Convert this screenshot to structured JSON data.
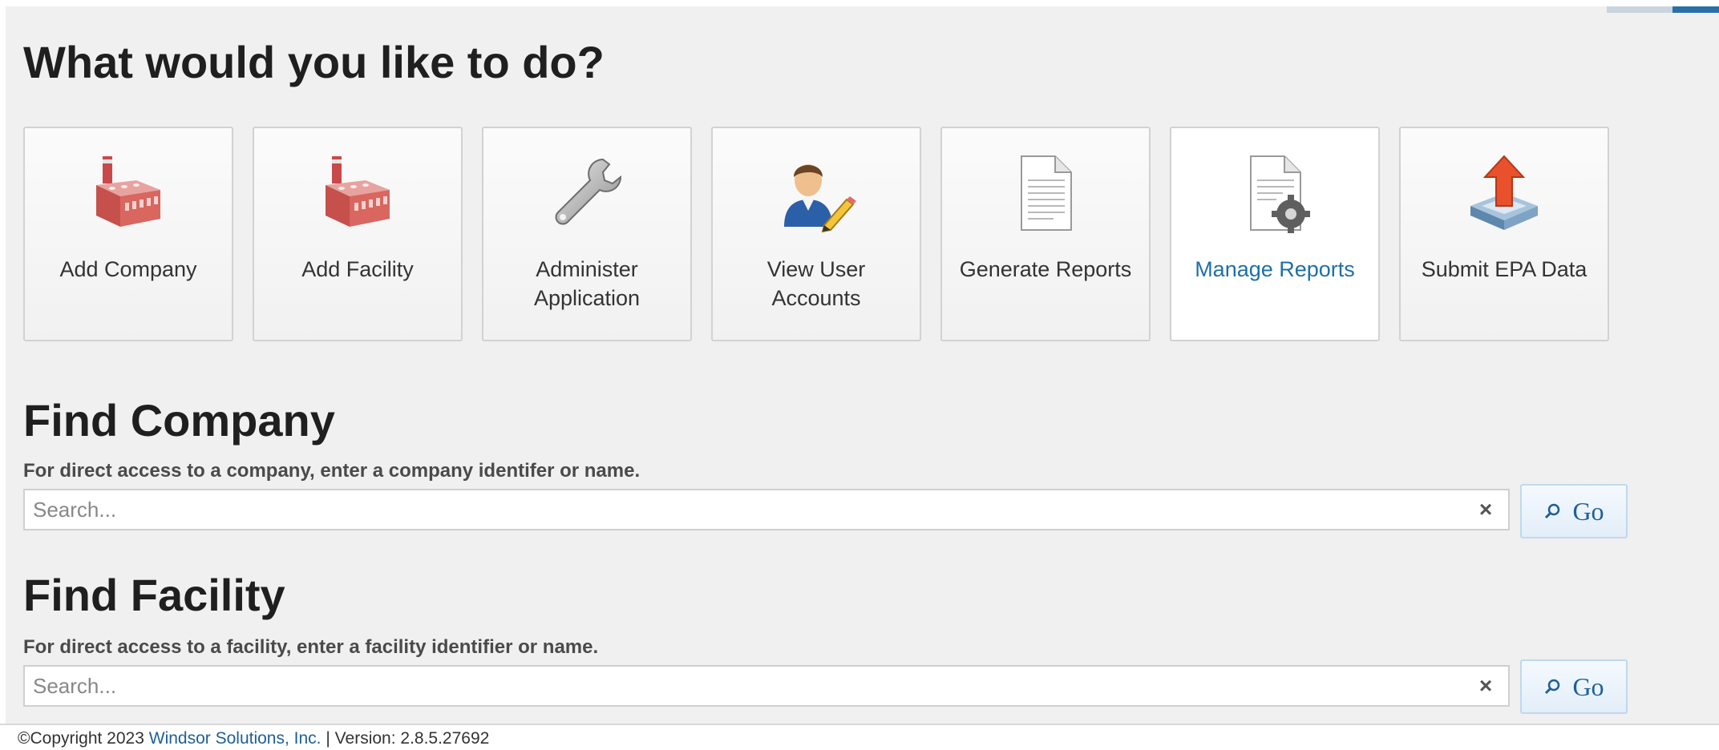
{
  "header": {
    "title": "What would you like to do?"
  },
  "actions": [
    {
      "label": "Add Company",
      "icon": "factory-icon"
    },
    {
      "label": "Add Facility",
      "icon": "factory-icon"
    },
    {
      "label": "Administer Application",
      "icon": "wrench-icon"
    },
    {
      "label": "View User Accounts",
      "icon": "user-edit-icon"
    },
    {
      "label": "Generate Reports",
      "icon": "document-icon"
    },
    {
      "label": "Manage Reports",
      "icon": "document-gear-icon",
      "active": true
    },
    {
      "label": "Submit EPA Data",
      "icon": "upload-tray-icon"
    }
  ],
  "find_company": {
    "title": "Find Company",
    "help": "For direct access to a company, enter a company identifer or name.",
    "placeholder": "Search...",
    "clear": "×",
    "go_label": "Go"
  },
  "find_facility": {
    "title": "Find Facility",
    "help": "For direct access to a facility, enter a facility identifier or name.",
    "placeholder": "Search...",
    "clear": "×",
    "go_label": "Go"
  },
  "footer": {
    "copyright": "©Copyright 2023",
    "company_link": "Windsor Solutions, Inc.",
    "separator": "|",
    "version": "Version: 2.8.5.27692"
  },
  "colors": {
    "link": "#1f5f96",
    "active_tile_text": "#1f6fa6",
    "page_bg": "#f0f0f0"
  }
}
